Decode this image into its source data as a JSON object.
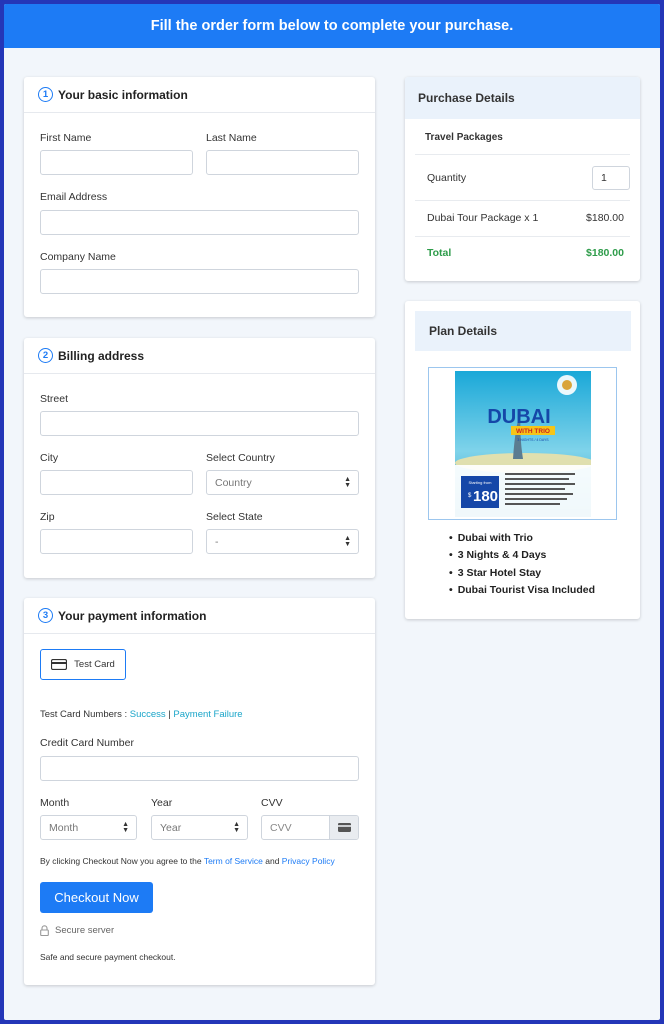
{
  "banner": {
    "title": "Fill the order form below to complete your purchase."
  },
  "basic_info": {
    "number": "1",
    "title": "Your basic information",
    "first_name_label": "First Name",
    "last_name_label": "Last Name",
    "email_label": "Email Address",
    "company_label": "Company Name"
  },
  "billing": {
    "number": "2",
    "title": "Billing address",
    "street_label": "Street",
    "city_label": "City",
    "country_label": "Select Country",
    "country_value": "Country",
    "zip_label": "Zip",
    "state_label": "Select State",
    "state_value": "-"
  },
  "payment": {
    "number": "3",
    "title": "Your payment information",
    "test_card_label": "Test Card",
    "test_numbers_label": "Test Card Numbers :",
    "success_link": "Success",
    "separator": "|",
    "failure_link": "Payment Failure",
    "cc_label": "Credit Card Number",
    "month_label": "Month",
    "month_value": "Month",
    "year_label": "Year",
    "year_value": "Year",
    "cvv_label": "CVV",
    "cvv_placeholder": "CVV",
    "agree_prefix": "By clicking Checkout Now you agree to the",
    "terms_link": "Term of Service",
    "and_text": "and",
    "privacy_link": "Privacy Policy",
    "checkout_button": "Checkout Now",
    "secure_server": "Secure server",
    "safe_text": "Safe and secure payment checkout."
  },
  "purchase": {
    "title": "Purchase Details",
    "subtitle": "Travel Packages",
    "quantity_label": "Quantity",
    "quantity_value": "1",
    "item_label": "Dubai Tour Package x 1",
    "item_price": "$180.00",
    "total_label": "Total",
    "total_value": "$180.00"
  },
  "plan": {
    "title": "Plan Details",
    "poster": {
      "title": "DUBAI",
      "ribbon": "WITH TRIO",
      "ribbon_sub": "3 NIGHTS / 4 DAYS",
      "starting_from": "Starting from",
      "price": "180",
      "currency": "$"
    },
    "features": [
      "Dubai with Trio",
      "3 Nights & 4 Days",
      "3 Star Hotel Stay",
      "Dubai Tourist Visa Included"
    ]
  },
  "colors": {
    "accent": "#1d7bf5",
    "total_green": "#2e9c4a",
    "link_teal": "#1aa5c9",
    "page_bg": "#f2f6fb",
    "outer_bg": "#2436b8"
  }
}
